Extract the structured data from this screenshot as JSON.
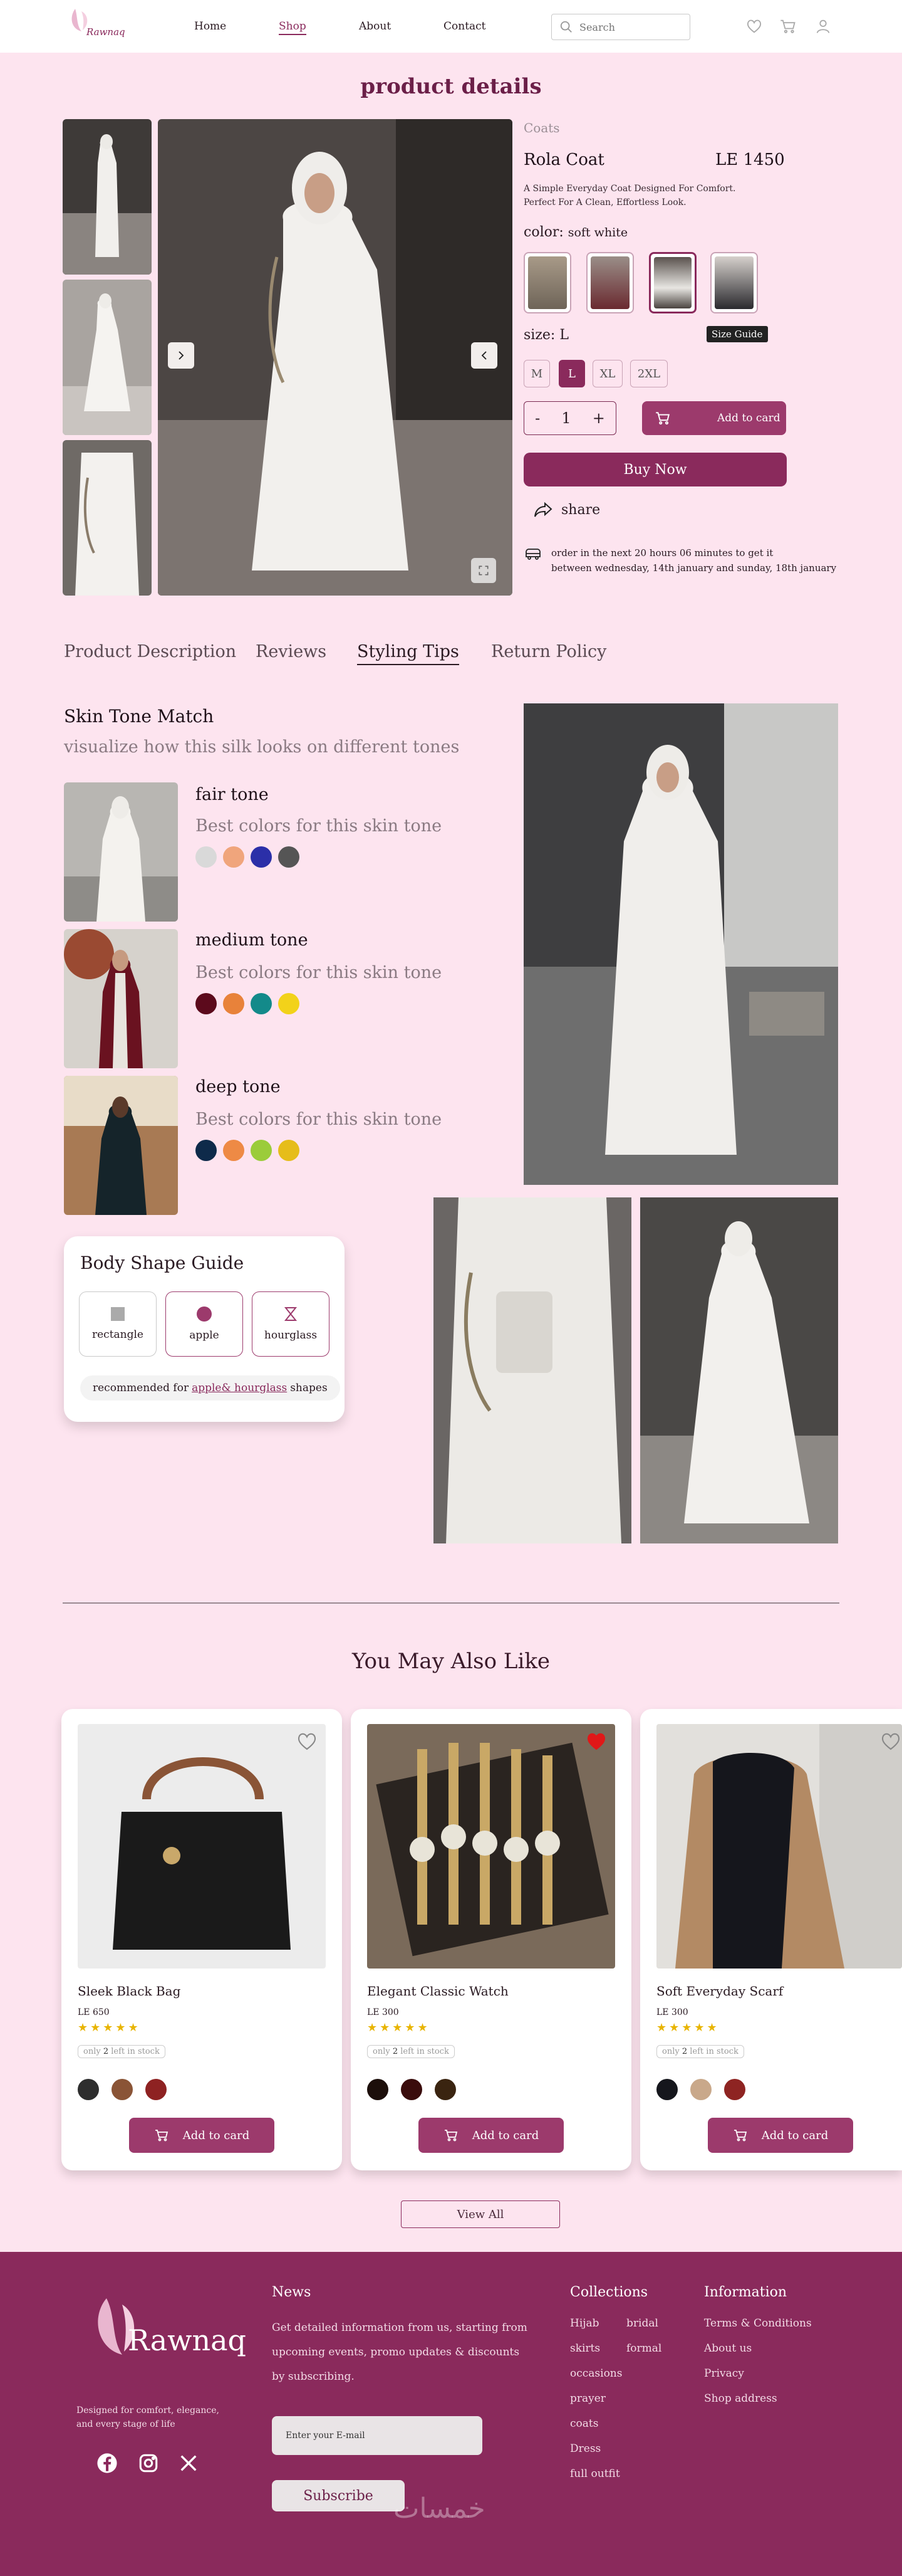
{
  "header": {
    "logo_text": "Rawnaq",
    "nav": [
      "Home",
      "Shop",
      "About",
      "Contact"
    ],
    "search_placeholder": "Search",
    "icons": [
      "heart-icon",
      "cart-icon",
      "user-icon"
    ]
  },
  "page_title": "product details",
  "product": {
    "category": "Coats",
    "name": "Rola Coat",
    "price": "LE 1450",
    "description_1": "A Simple Everyday Coat Designed For Comfort.",
    "description_2": "Perfect For A Clean, Effortless Look.",
    "color_label": "color:",
    "color_value": "soft white",
    "size_label": "size:",
    "size_value": "L",
    "size_guide": "Size Guide",
    "sizes": [
      "M",
      "L",
      "XL",
      "2XL"
    ],
    "selected_size": "L",
    "qty_minus": "-",
    "qty": "1",
    "qty_plus": "+",
    "add_to_card": "Add to card",
    "buy_now": "Buy Now",
    "share": "share",
    "delivery_1": "order in the next 20 hours 06 minutes to get it",
    "delivery_2": "between wednesday, 14th january and sunday, 18th january"
  },
  "tabs": [
    "Product Description",
    "Reviews",
    "Styling Tips",
    "Return Policy"
  ],
  "active_tab": "Styling Tips",
  "styling": {
    "title": "Skin Tone Match",
    "subtitle": "visualize how this silk looks on different tones",
    "best_text": "Best colors for this  skin tone",
    "tones": [
      {
        "name": "fair tone",
        "colors": [
          "#d9d9d9",
          "#f0a57c",
          "#2b2fa8",
          "#555555"
        ]
      },
      {
        "name": "medium tone",
        "colors": [
          "#5c0a1c",
          "#e8823a",
          "#138a8a",
          "#f2d21a"
        ]
      },
      {
        "name": "deep tone",
        "colors": [
          "#0e2a4a",
          "#ee8a45",
          "#9bcc3a",
          "#e6bd1a"
        ]
      }
    ]
  },
  "body_shape": {
    "title": "Body Shape Guide",
    "shapes": [
      "rectangle",
      "apple",
      "hourglass"
    ],
    "selected": [
      "apple",
      "hourglass"
    ],
    "rec_prefix": "recommended for",
    "rec_highlight": "apple& hourglass",
    "rec_suffix": "shapes"
  },
  "also_like": {
    "title": "You May Also Like",
    "products": [
      {
        "name": "Sleek Black Bag",
        "price": "LE 650",
        "stock_prefix": "only",
        "stock_count": "2",
        "stock_suffix": "left in stock",
        "colors": [
          "#2e2e2e",
          "#8a5436",
          "#8e2222"
        ],
        "favorited": false
      },
      {
        "name": "Elegant Classic Watch",
        "price": "LE 300",
        "stock_prefix": "only",
        "stock_count": "2",
        "stock_suffix": "left in stock",
        "colors": [
          "#1c0e0a",
          "#3a0c0c",
          "#3a2410"
        ],
        "favorited": true
      },
      {
        "name": "Soft Everyday Scarf",
        "price": "LE 300",
        "stock_prefix": "only",
        "stock_count": "2",
        "stock_suffix": "left in stock",
        "colors": [
          "#15161c",
          "#c9a88a",
          "#8e2422"
        ],
        "favorited": false
      }
    ],
    "stars": "★★★★★",
    "add_to_card": "Add to card",
    "view_all": "View All"
  },
  "footer": {
    "logo_text": "Rawnaq",
    "tagline_1": "Designed for comfort, elegance,",
    "tagline_2": "and every stage of life",
    "news_title": "News",
    "news_text": "Get detailed information from us, starting from upcoming events, promo updates & discounts by subscribing.",
    "email_placeholder": "Enter your E-mail",
    "subscribe": "Subscribe",
    "collections_title": "Collections",
    "collections_col1": [
      "Hijab",
      "skirts",
      "occasions",
      "prayer",
      "coats",
      "Dress",
      "full outfit"
    ],
    "collections_col2": [
      "bridal",
      "formal"
    ],
    "information_title": "Information",
    "information": [
      "Terms & Conditions",
      "About us",
      "Privacy",
      "Shop address"
    ],
    "watermark": "خمسات"
  },
  "colors": {
    "accent": "#8a2a5c",
    "background": "#fde4ef",
    "button": "#9c3a6c"
  }
}
